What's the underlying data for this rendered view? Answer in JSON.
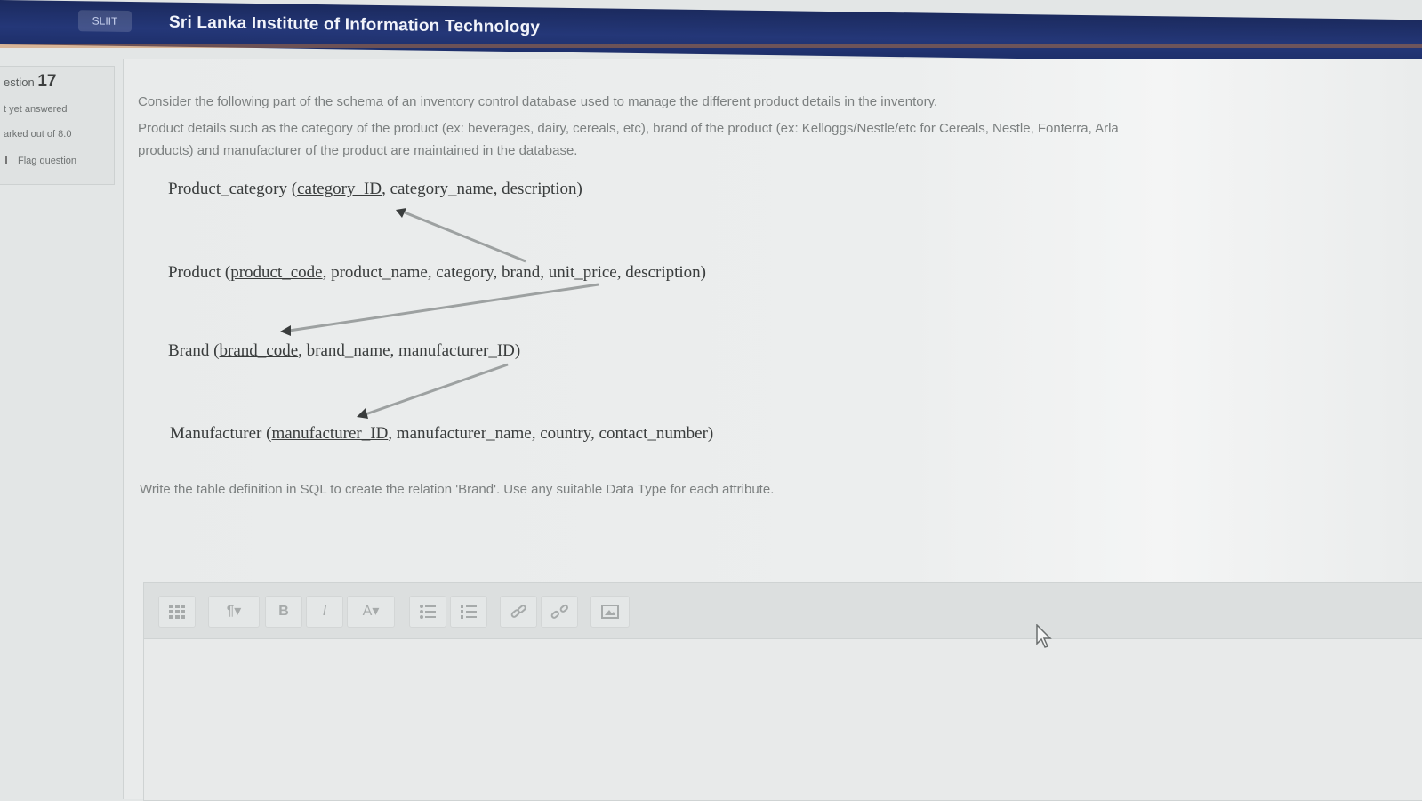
{
  "header": {
    "logo_text": "SLIIT",
    "site_title": "Sri Lanka Institute of Information Technology"
  },
  "sidebar": {
    "question_label": "estion",
    "question_number": "17",
    "status": "t yet answered",
    "marks": "arked out of 8.0",
    "flag_label": "Flag question"
  },
  "question": {
    "intro_line1": "Consider the following part of the schema of an inventory control database used to manage the different product details in the inventory.",
    "intro_line2": "Product details such as the category of the product (ex: beverages, dairy, cereals, etc), brand of the product (ex: Kelloggs/Nestle/etc for Cereals, Nestle, Fonterra, Arla",
    "intro_line3": "products) and manufacturer of the product are maintained in the database.",
    "schema": {
      "product_category": {
        "name": "Product_category (",
        "pk": "category_ID",
        "rest": ", category_name, description)"
      },
      "product": {
        "name": "Product (",
        "pk": "product_code",
        "rest": ", product_name, category, brand, unit_price, description)"
      },
      "brand": {
        "name": "Brand (",
        "pk": "brand_code",
        "rest": ", brand_name, manufacturer_ID)"
      },
      "manufacturer": {
        "name": "Manufacturer (",
        "pk": "manufacturer_ID",
        "rest": ", manufacturer_name, country, contact_number)"
      }
    },
    "instruction": "Write the table definition in SQL to create the relation 'Brand'. Use any suitable Data Type for each attribute."
  },
  "editor": {
    "toolbar": [
      {
        "name": "toggle-toolbar-button",
        "icon": "grid-icon",
        "label": ""
      },
      {
        "name": "paragraph-style-button",
        "icon": "paragraph-icon",
        "label": "¶▾"
      },
      {
        "name": "bold-button",
        "icon": "bold-icon",
        "label": "B"
      },
      {
        "name": "italic-button",
        "icon": "italic-icon",
        "label": "I"
      },
      {
        "name": "font-color-button",
        "icon": "font-color-icon",
        "label": "A▾"
      },
      {
        "name": "unordered-list-button",
        "icon": "bullet-list-icon",
        "label": ""
      },
      {
        "name": "ordered-list-button",
        "icon": "numbered-list-icon",
        "label": ""
      },
      {
        "name": "link-button",
        "icon": "link-icon",
        "label": ""
      },
      {
        "name": "unlink-button",
        "icon": "unlink-icon",
        "label": ""
      },
      {
        "name": "insert-image-button",
        "icon": "image-icon",
        "label": ""
      }
    ],
    "content": ""
  }
}
